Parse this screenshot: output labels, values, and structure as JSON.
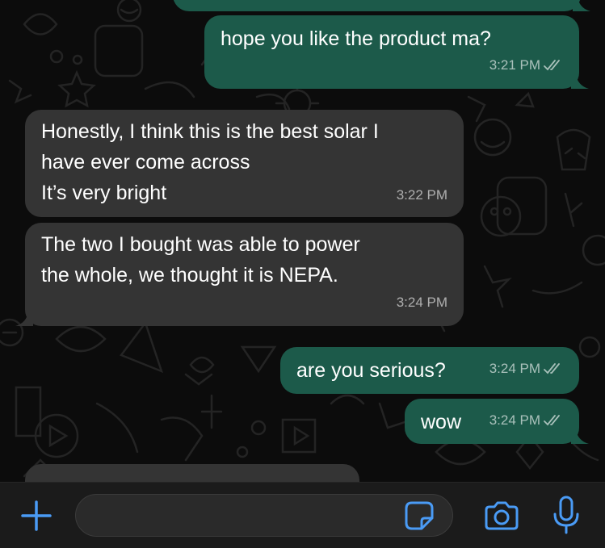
{
  "theme": {
    "outgoing_bubble": "#1c5a4a",
    "incoming_bubble": "#343434",
    "accent": "#4a9bf5",
    "read_tick": "rgba(255,255,255,0.62)"
  },
  "messages": [
    {
      "direction": "outgoing",
      "text": "",
      "time": "",
      "status": "read",
      "note": "partially visible bubble at top edge"
    },
    {
      "direction": "outgoing",
      "text": "hope you like the product ma?",
      "time": "3:21 PM",
      "status": "read"
    },
    {
      "direction": "incoming",
      "text": "Honestly, I think this is the best solar I\nhave ever come across\nIt’s very bright",
      "time": "3:22 PM"
    },
    {
      "direction": "incoming",
      "text": "The two I bought was able to power\nthe whole, we thought it is NEPA.",
      "time": "3:24 PM"
    },
    {
      "direction": "outgoing",
      "text": "are you serious?",
      "time": "3:24 PM",
      "status": "read"
    },
    {
      "direction": "outgoing",
      "text": "wow",
      "time": "3:24 PM",
      "status": "read"
    },
    {
      "direction": "incoming",
      "text": "",
      "time": "",
      "note": "partially visible bubble at bottom edge"
    }
  ],
  "composer": {
    "placeholder": "",
    "value": "",
    "icons": [
      "plus-icon",
      "sticker-icon",
      "camera-icon",
      "microphone-icon"
    ]
  }
}
